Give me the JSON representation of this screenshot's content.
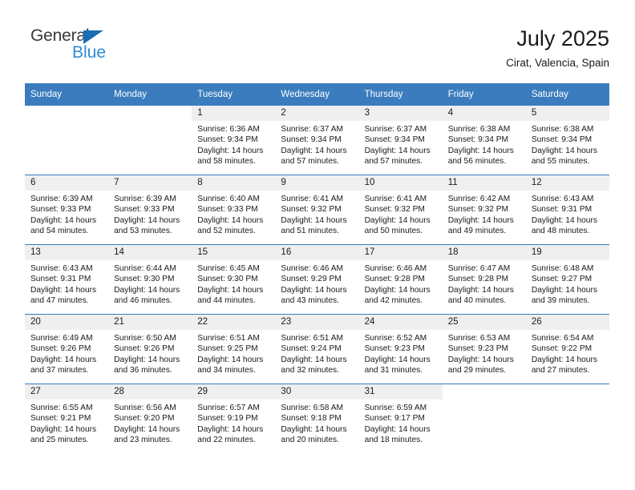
{
  "logo": {
    "word_one": "General",
    "word_two": "Blue",
    "triangle_icon": "triangle-icon",
    "brand_blue": "#2e8bd4",
    "triangle_blue": "#1b6cb5"
  },
  "header": {
    "title": "July 2025",
    "location": "Cirat, Valencia, Spain"
  },
  "colors": {
    "header_row": "#3a7cbe",
    "daynum_band": "#efefef",
    "text": "#1a1a1a"
  },
  "calendar": {
    "weekday_headers": [
      "Sunday",
      "Monday",
      "Tuesday",
      "Wednesday",
      "Thursday",
      "Friday",
      "Saturday"
    ],
    "weeks": [
      [
        {
          "day": "",
          "lines": []
        },
        {
          "day": "",
          "lines": []
        },
        {
          "day": "1",
          "lines": [
            "Sunrise: 6:36 AM",
            "Sunset: 9:34 PM",
            "Daylight: 14 hours",
            "and 58 minutes."
          ]
        },
        {
          "day": "2",
          "lines": [
            "Sunrise: 6:37 AM",
            "Sunset: 9:34 PM",
            "Daylight: 14 hours",
            "and 57 minutes."
          ]
        },
        {
          "day": "3",
          "lines": [
            "Sunrise: 6:37 AM",
            "Sunset: 9:34 PM",
            "Daylight: 14 hours",
            "and 57 minutes."
          ]
        },
        {
          "day": "4",
          "lines": [
            "Sunrise: 6:38 AM",
            "Sunset: 9:34 PM",
            "Daylight: 14 hours",
            "and 56 minutes."
          ]
        },
        {
          "day": "5",
          "lines": [
            "Sunrise: 6:38 AM",
            "Sunset: 9:34 PM",
            "Daylight: 14 hours",
            "and 55 minutes."
          ]
        }
      ],
      [
        {
          "day": "6",
          "lines": [
            "Sunrise: 6:39 AM",
            "Sunset: 9:33 PM",
            "Daylight: 14 hours",
            "and 54 minutes."
          ]
        },
        {
          "day": "7",
          "lines": [
            "Sunrise: 6:39 AM",
            "Sunset: 9:33 PM",
            "Daylight: 14 hours",
            "and 53 minutes."
          ]
        },
        {
          "day": "8",
          "lines": [
            "Sunrise: 6:40 AM",
            "Sunset: 9:33 PM",
            "Daylight: 14 hours",
            "and 52 minutes."
          ]
        },
        {
          "day": "9",
          "lines": [
            "Sunrise: 6:41 AM",
            "Sunset: 9:32 PM",
            "Daylight: 14 hours",
            "and 51 minutes."
          ]
        },
        {
          "day": "10",
          "lines": [
            "Sunrise: 6:41 AM",
            "Sunset: 9:32 PM",
            "Daylight: 14 hours",
            "and 50 minutes."
          ]
        },
        {
          "day": "11",
          "lines": [
            "Sunrise: 6:42 AM",
            "Sunset: 9:32 PM",
            "Daylight: 14 hours",
            "and 49 minutes."
          ]
        },
        {
          "day": "12",
          "lines": [
            "Sunrise: 6:43 AM",
            "Sunset: 9:31 PM",
            "Daylight: 14 hours",
            "and 48 minutes."
          ]
        }
      ],
      [
        {
          "day": "13",
          "lines": [
            "Sunrise: 6:43 AM",
            "Sunset: 9:31 PM",
            "Daylight: 14 hours",
            "and 47 minutes."
          ]
        },
        {
          "day": "14",
          "lines": [
            "Sunrise: 6:44 AM",
            "Sunset: 9:30 PM",
            "Daylight: 14 hours",
            "and 46 minutes."
          ]
        },
        {
          "day": "15",
          "lines": [
            "Sunrise: 6:45 AM",
            "Sunset: 9:30 PM",
            "Daylight: 14 hours",
            "and 44 minutes."
          ]
        },
        {
          "day": "16",
          "lines": [
            "Sunrise: 6:46 AM",
            "Sunset: 9:29 PM",
            "Daylight: 14 hours",
            "and 43 minutes."
          ]
        },
        {
          "day": "17",
          "lines": [
            "Sunrise: 6:46 AM",
            "Sunset: 9:28 PM",
            "Daylight: 14 hours",
            "and 42 minutes."
          ]
        },
        {
          "day": "18",
          "lines": [
            "Sunrise: 6:47 AM",
            "Sunset: 9:28 PM",
            "Daylight: 14 hours",
            "and 40 minutes."
          ]
        },
        {
          "day": "19",
          "lines": [
            "Sunrise: 6:48 AM",
            "Sunset: 9:27 PM",
            "Daylight: 14 hours",
            "and 39 minutes."
          ]
        }
      ],
      [
        {
          "day": "20",
          "lines": [
            "Sunrise: 6:49 AM",
            "Sunset: 9:26 PM",
            "Daylight: 14 hours",
            "and 37 minutes."
          ]
        },
        {
          "day": "21",
          "lines": [
            "Sunrise: 6:50 AM",
            "Sunset: 9:26 PM",
            "Daylight: 14 hours",
            "and 36 minutes."
          ]
        },
        {
          "day": "22",
          "lines": [
            "Sunrise: 6:51 AM",
            "Sunset: 9:25 PM",
            "Daylight: 14 hours",
            "and 34 minutes."
          ]
        },
        {
          "day": "23",
          "lines": [
            "Sunrise: 6:51 AM",
            "Sunset: 9:24 PM",
            "Daylight: 14 hours",
            "and 32 minutes."
          ]
        },
        {
          "day": "24",
          "lines": [
            "Sunrise: 6:52 AM",
            "Sunset: 9:23 PM",
            "Daylight: 14 hours",
            "and 31 minutes."
          ]
        },
        {
          "day": "25",
          "lines": [
            "Sunrise: 6:53 AM",
            "Sunset: 9:23 PM",
            "Daylight: 14 hours",
            "and 29 minutes."
          ]
        },
        {
          "day": "26",
          "lines": [
            "Sunrise: 6:54 AM",
            "Sunset: 9:22 PM",
            "Daylight: 14 hours",
            "and 27 minutes."
          ]
        }
      ],
      [
        {
          "day": "27",
          "lines": [
            "Sunrise: 6:55 AM",
            "Sunset: 9:21 PM",
            "Daylight: 14 hours",
            "and 25 minutes."
          ]
        },
        {
          "day": "28",
          "lines": [
            "Sunrise: 6:56 AM",
            "Sunset: 9:20 PM",
            "Daylight: 14 hours",
            "and 23 minutes."
          ]
        },
        {
          "day": "29",
          "lines": [
            "Sunrise: 6:57 AM",
            "Sunset: 9:19 PM",
            "Daylight: 14 hours",
            "and 22 minutes."
          ]
        },
        {
          "day": "30",
          "lines": [
            "Sunrise: 6:58 AM",
            "Sunset: 9:18 PM",
            "Daylight: 14 hours",
            "and 20 minutes."
          ]
        },
        {
          "day": "31",
          "lines": [
            "Sunrise: 6:59 AM",
            "Sunset: 9:17 PM",
            "Daylight: 14 hours",
            "and 18 minutes."
          ]
        },
        {
          "day": "",
          "lines": []
        },
        {
          "day": "",
          "lines": []
        }
      ]
    ]
  }
}
